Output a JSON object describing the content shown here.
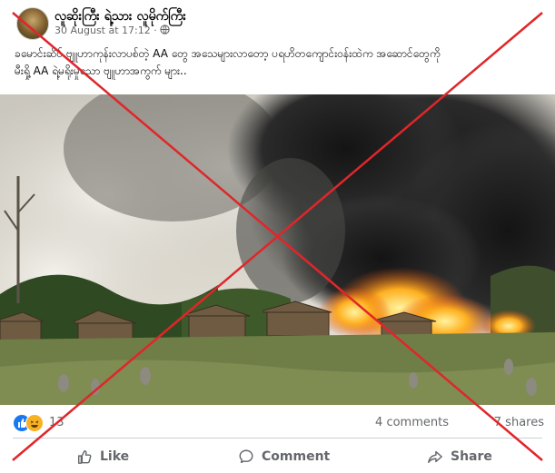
{
  "post": {
    "author": "လူဆိုးကြီး ရဲ့သား လူမိုက်ကြီး",
    "timestamp": "30 August at 17:12 ·",
    "text_lines": [
      "ခမောင်းဆိပ် ဗျူဟာကုန်းလာပစ်တဲ့ AA တွေ အသေများလာတော့ ပရဟိတကျောင်းဝန်းထဲက အဆောင်တွေကို",
      "မီးရှို့ AA ရဲ့မရိုးမှုသော ဗျူဟာအကွက် များ.."
    ],
    "reaction_count": "13",
    "comments_count": "4 comments",
    "shares_count": "7 shares"
  },
  "actions": {
    "like_label": "Like",
    "comment_label": "Comment",
    "share_label": "Share"
  },
  "colors": {
    "like_blue": "#1877f2",
    "haha_yellow": "#f7b125",
    "overlay_red": "#e0262a",
    "muted_text": "#65676b"
  },
  "icons": [
    "globe-icon",
    "like-reaction-icon",
    "haha-reaction-icon",
    "thumbs-up-icon",
    "comment-icon",
    "share-icon"
  ]
}
